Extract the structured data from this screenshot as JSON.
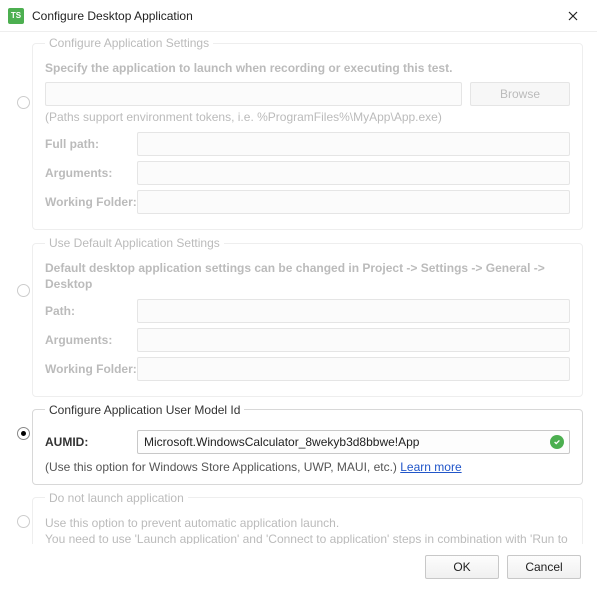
{
  "window": {
    "title": "Configure Desktop Application",
    "icon_text": "TS"
  },
  "opt1": {
    "legend": "Configure Application Settings",
    "desc": "Specify the application to launch when recording or executing this test.",
    "browse": "Browse",
    "note": "(Paths support environment tokens, i.e. %ProgramFiles%\\MyApp\\App.exe)",
    "fullpath_label": "Full path:",
    "args_label": "Arguments:",
    "wf_label": "Working Folder:",
    "fullpath": "",
    "args": "",
    "wf": ""
  },
  "opt2": {
    "legend": "Use Default Application Settings",
    "desc": "Default desktop application settings can be changed in Project -> Settings -> General -> Desktop",
    "path_label": "Path:",
    "args_label": "Arguments:",
    "wf_label": "Working Folder:",
    "path": "",
    "args": "",
    "wf": ""
  },
  "opt3": {
    "legend": "Configure Application User Model Id",
    "aumid_label": "AUMID:",
    "aumid_value": "Microsoft.WindowsCalculator_8wekyb3d8bbwe!App",
    "hint_prefix": "(Use this option for Windows Store Applications, UWP, MAUI, etc.)  ",
    "learn_more": "Learn more"
  },
  "opt4": {
    "legend": "Do not launch application",
    "desc": "Use this option to prevent automatic application launch.\nYou need to use 'Launch application' and 'Connect to application' steps in combination with 'Run to Here' or 'Run Selected' for test recording and execution."
  },
  "footer": {
    "ok": "OK",
    "cancel": "Cancel"
  }
}
